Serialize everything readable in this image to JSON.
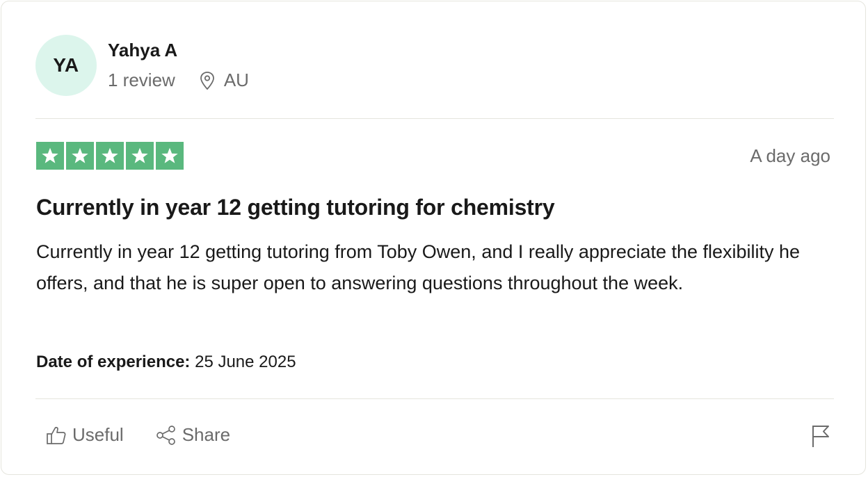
{
  "reviewer": {
    "initials": "YA",
    "name": "Yahya A",
    "review_count": "1 review",
    "location": "AU"
  },
  "review": {
    "rating": 5,
    "rating_max": 5,
    "star_color": "#5ab87e",
    "date_ago": "A day ago",
    "title": "Currently in year 12 getting tutoring for chemistry",
    "body": "Currently in year 12 getting tutoring from Toby Owen, and I really appreciate the flexibility he offers, and that he is super open to answering questions throughout the week.",
    "date_of_experience_label": "Date of experience:",
    "date_of_experience_value": "25 June 2025"
  },
  "actions": {
    "useful_label": "Useful",
    "share_label": "Share",
    "useful_icon": "thumbs-up-icon",
    "share_icon": "share-icon",
    "flag_icon": "flag-icon",
    "location_icon": "location-pin-icon"
  }
}
